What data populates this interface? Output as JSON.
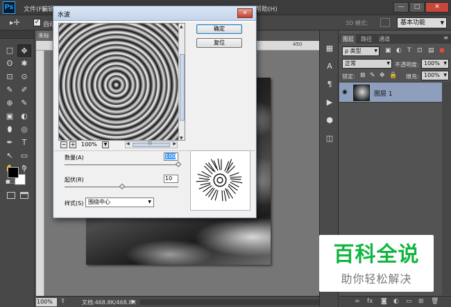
{
  "app": {
    "logo": "Ps",
    "menu": [
      "文件(F)",
      "编辑(E)",
      "帮助(H)"
    ],
    "window_controls": {
      "minimize": "—",
      "maximize": "□",
      "close": "✕"
    }
  },
  "options_bar": {
    "tool_icon": "move-tool-icon",
    "auto_select_label": "自动",
    "auto_checked": "✓",
    "mode_3d_label": "3D 模式:",
    "workspace": "基本功能"
  },
  "tools": [
    "□",
    "✥",
    "ʘ",
    "✱",
    "⊡",
    "⊙",
    "✎",
    "✐",
    "⊕",
    "✎",
    "▣",
    "◐",
    "⬮",
    "◎",
    "✒",
    "T",
    "↖",
    "▭",
    "✋",
    "⚲"
  ],
  "colors": {
    "foreground": "#000000",
    "background": "#ffffff",
    "layer_selected": "#8e9fbd",
    "dialog_bg": "#f0f0f0",
    "watermark_green": "#12b53f"
  },
  "document": {
    "tab_label": "未标",
    "ruler_mark": "450",
    "zoom": "100%",
    "info": "文档:468.8K/468.8K"
  },
  "dialog": {
    "title": "水波",
    "close": "✕",
    "ok_label": "确定",
    "reset_label": "复位",
    "preview_zoom": "100%",
    "zoom_out": "−",
    "zoom_in": "+",
    "amount_label": "数量(A)",
    "amount_value": "100",
    "ridges_label": "起伏(R)",
    "ridges_value": "10",
    "style_label": "样式(S)",
    "style_value": "围绕中心"
  },
  "layers": {
    "tabs": [
      "图层",
      "路径",
      "通道"
    ],
    "kind_filter": "ρ 类型",
    "blend_mode": "正常",
    "opacity_label": "不透明度:",
    "opacity_value": "100%",
    "lock_label": "锁定:",
    "fill_label": "填充:",
    "fill_value": "100%",
    "layer_name": "图层 1"
  },
  "watermark": {
    "title": "百科全说",
    "subtitle": "助你轻松解决"
  }
}
